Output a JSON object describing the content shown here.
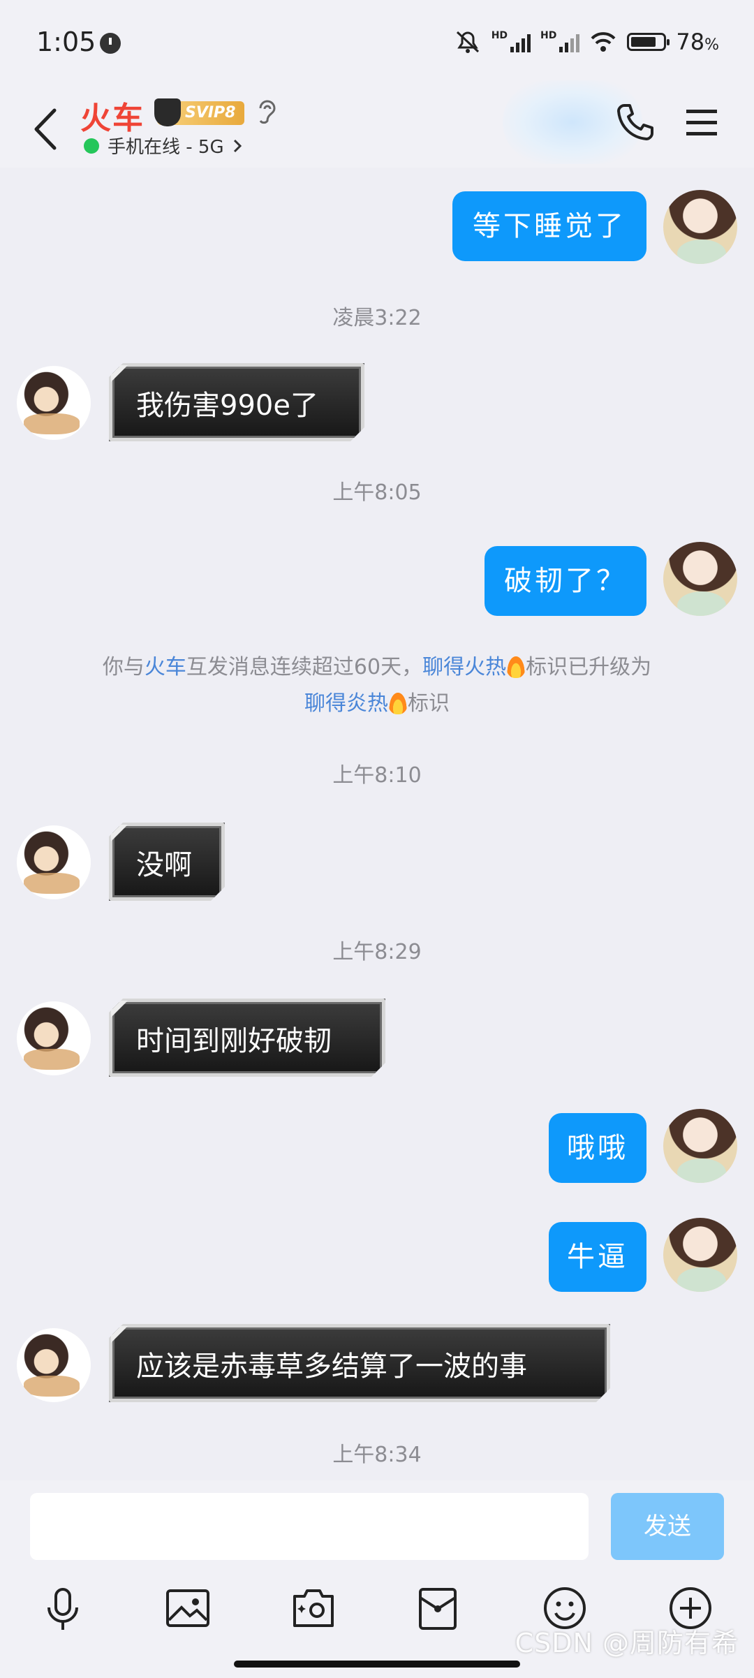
{
  "status_bar": {
    "time": "1:05",
    "network_1": "HD",
    "network_2": "HD",
    "battery": "78",
    "battery_unit": "%"
  },
  "header": {
    "contact_name": "火车",
    "vip_badge": "SVIP8",
    "online_status": "手机在线 - 5G",
    "icons": [
      "back-arrow-icon",
      "ear-icon",
      "phone-icon",
      "menu-icon"
    ]
  },
  "messages": {
    "m1": "等下睡觉了",
    "ts1": "凌晨3:22",
    "m2": "我伤害990e了",
    "ts2": "上午8:05",
    "m3": "破韧了？",
    "system_notice": {
      "p1": "你与",
      "name": "火车",
      "p2": "互发消息连续超过60天，",
      "hot1": "聊得火热",
      "p3": "标识已升级为",
      "hot2": "聊得炎热",
      "p4": "标识"
    },
    "ts3": "上午8:10",
    "m4": "没啊",
    "ts4": "上午8:29",
    "m5": "时间到刚好破韧",
    "m6": "哦哦",
    "m7": "牛逼",
    "m8": "应该是赤毒草多结算了一波的事",
    "ts5": "上午8:34"
  },
  "input": {
    "placeholder": "",
    "send_label": "发送"
  },
  "toolbar": [
    "microphone-icon",
    "image-icon",
    "camera-icon",
    "red-packet-icon",
    "emoji-icon",
    "plus-icon"
  ],
  "watermark": "CSDN @周防有希",
  "colors": {
    "accent": "#0e99fb",
    "name": "#ef4436",
    "online": "#25c65a",
    "send_disabled": "#7dc6fb"
  }
}
